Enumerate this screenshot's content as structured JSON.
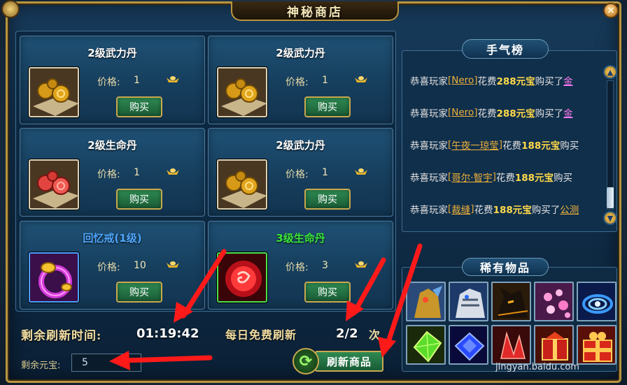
{
  "window": {
    "title": "神秘商店",
    "close_label": "×"
  },
  "shop": {
    "price_label": "价格:",
    "buy_label": "购买",
    "items": [
      {
        "name": "2级武力丹",
        "price": "1",
        "color": "#ffffff",
        "icon": "gold-pills-icon"
      },
      {
        "name": "2级武力丹",
        "price": "1",
        "color": "#ffffff",
        "icon": "gold-pills-icon"
      },
      {
        "name": "2级生命丹",
        "price": "1",
        "color": "#ffffff",
        "icon": "red-pills-icon"
      },
      {
        "name": "2级武力丹",
        "price": "1",
        "color": "#ffffff",
        "icon": "gold-pills-icon"
      },
      {
        "name": "回忆戒(1级)",
        "price": "10",
        "color": "#4fa8ff",
        "icon": "ring-icon"
      },
      {
        "name": "3级生命丹",
        "price": "3",
        "color": "#3ae63a",
        "icon": "red-orb-icon"
      }
    ]
  },
  "footer": {
    "refresh_label": "剩余刷新时间:",
    "refresh_time": "01:19:42",
    "daily_label": "每日免费刷新",
    "daily_count": "2/2",
    "daily_unit": "次",
    "balance_label": "剩余元宝:",
    "balance_value": "5",
    "refresh_button": "刷新商品"
  },
  "ranking": {
    "title": "手气榜",
    "entries": [
      {
        "prefix": "恭喜玩家",
        "player": "Nero",
        "mid": "花费",
        "cost": "288元宝",
        "suffix": "购买了",
        "item": "金"
      },
      {
        "prefix": "恭喜玩家",
        "player": "Nero",
        "mid": "花费",
        "cost": "288元宝",
        "suffix": "购买了",
        "item": "金"
      },
      {
        "prefix": "恭喜玩家",
        "player": "午夜一琼莹",
        "mid": "花费",
        "cost": "188元宝",
        "suffix": "购买",
        "item": ""
      },
      {
        "prefix": "恭喜玩家",
        "player": "哥尔·智宇",
        "mid": "花费",
        "cost": "188元宝",
        "suffix": "购买",
        "item": ""
      },
      {
        "prefix": "恭喜玩家",
        "player": "裁缝",
        "mid": "花费",
        "cost": "188元宝",
        "suffix": "购买了",
        "item": "公测"
      }
    ]
  },
  "rare": {
    "title": "稀有物品",
    "items": [
      {
        "icon": "golden-beast-icon"
      },
      {
        "icon": "white-tiger-icon"
      },
      {
        "icon": "dark-wolf-icon"
      },
      {
        "icon": "pink-petals-icon"
      },
      {
        "icon": "blue-vortex-icon"
      },
      {
        "icon": "green-gem-icon"
      },
      {
        "icon": "blue-gem-icon"
      },
      {
        "icon": "red-crystal-icon"
      },
      {
        "icon": "red-box-icon"
      },
      {
        "icon": "red-gift-icon"
      }
    ]
  },
  "watermark": "jingyan.baidu.com"
}
